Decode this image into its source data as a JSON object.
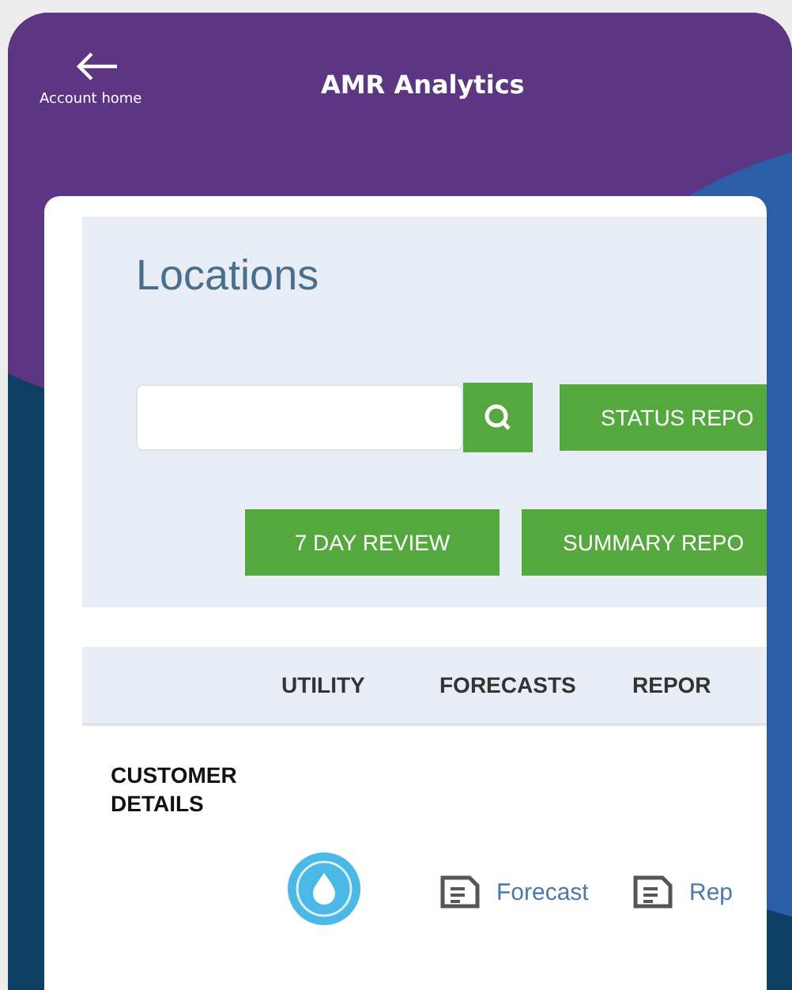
{
  "header": {
    "back_label": "Account home",
    "title": "AMR Analytics"
  },
  "locations": {
    "title": "Locations",
    "search_buttons": [
      "STATUS REPO"
    ],
    "buttons": [
      "7 DAY REVIEW",
      "SUMMARY REPO"
    ]
  },
  "table": {
    "columns": [
      "UTILITY",
      "FORECASTS",
      "REPOR"
    ],
    "rows": [
      {
        "label": "CUSTOMER DETAILS",
        "utility": {
          "kind": "water"
        },
        "forecast_link": "Forecast",
        "report_link": "Rep"
      }
    ]
  }
}
